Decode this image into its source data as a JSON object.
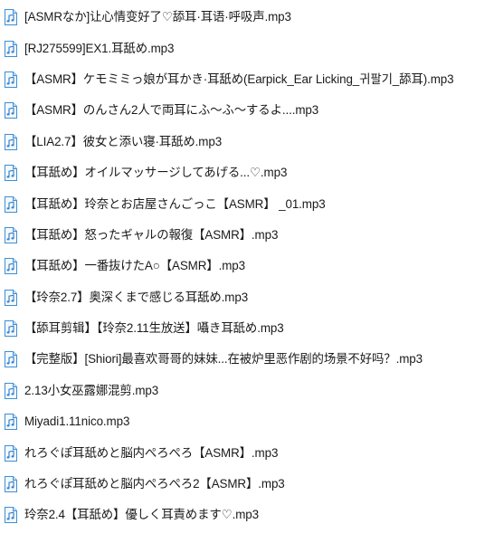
{
  "icon": "audio-file-icon",
  "colors": {
    "icon_stroke": "#3d8fd6",
    "icon_fill": "#f3f8fd",
    "icon_fold": "#cfe3f6",
    "icon_note": "#2f7fc8"
  },
  "files": [
    {
      "name": "[ASMRなか]让心情变好了♡舔耳·耳语·呼吸声.mp3"
    },
    {
      "name": "[RJ275599]EX1.耳舐め.mp3"
    },
    {
      "name": "【ASMR】ケモミミっ娘が耳かき·耳舐め(Earpick_Ear Licking_귀팔기_舔耳).mp3"
    },
    {
      "name": "【ASMR】のんさん2人で両耳にふ～ふ～するよ....mp3"
    },
    {
      "name": "【LIA2.7】彼女と添い寝·耳舐め.mp3"
    },
    {
      "name": "【耳舐め】オイルマッサージしてあげる...♡.mp3"
    },
    {
      "name": "【耳舐め】玲奈とお店屋さんごっこ【ASMR】 _01.mp3"
    },
    {
      "name": "【耳舐め】怒ったギャルの報復【ASMR】.mp3"
    },
    {
      "name": "【耳舐め】一番抜けたA○【ASMR】.mp3"
    },
    {
      "name": "【玲奈2.7】奥深くまで感じる耳舐め.mp3"
    },
    {
      "name": "【舔耳剪辑】【玲奈2.11生放送】囁き耳舐め.mp3"
    },
    {
      "name": "【完整版】[Shiori]最喜欢哥哥的妹妹...在被炉里恶作剧的场景不好吗？.mp3"
    },
    {
      "name": "2.13小女巫露娜混剪.mp3"
    },
    {
      "name": "Miyadi1.11nico.mp3"
    },
    {
      "name": "れろぐぽ耳舐めと脳内ぺろぺろ【ASMR】.mp3"
    },
    {
      "name": "れろぐぽ耳舐めと脳内ぺろぺろ2【ASMR】.mp3"
    },
    {
      "name": "玲奈2.4【耳舐め】優しく耳責めます♡.mp3"
    }
  ]
}
